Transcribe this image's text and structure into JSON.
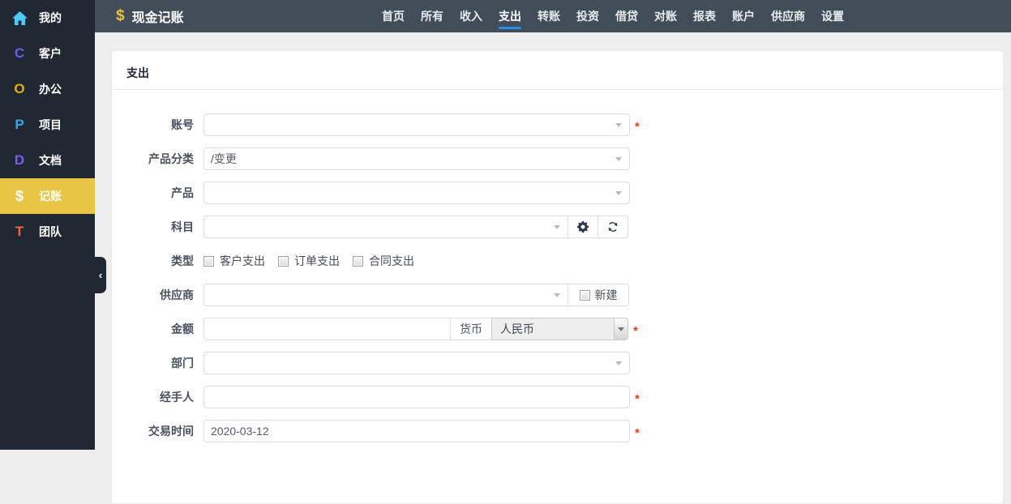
{
  "colors": {
    "sidebar_bg": "#212834",
    "sidebar_active_bg": "#e9c546",
    "topbar_bg": "#414d59",
    "nav_active_underline": "#2d8cf0",
    "required_red": "#ed4014",
    "card_bg": "#ffffff",
    "page_bg": "#eeeeee"
  },
  "sidebar": {
    "items": [
      {
        "label": "我的",
        "icon": "home-icon",
        "glyph": "",
        "active": false
      },
      {
        "label": "客户",
        "icon": "letter-c-icon",
        "glyph": "C",
        "active": false
      },
      {
        "label": "办公",
        "icon": "letter-o-icon",
        "glyph": "O",
        "active": false
      },
      {
        "label": "项目",
        "icon": "letter-p-icon",
        "glyph": "P",
        "active": false
      },
      {
        "label": "文档",
        "icon": "letter-d-icon",
        "glyph": "D",
        "active": false
      },
      {
        "label": "记账",
        "icon": "dollar-icon",
        "glyph": "$",
        "active": true
      },
      {
        "label": "团队",
        "icon": "letter-t-icon",
        "glyph": "T",
        "active": false
      }
    ],
    "collapse_glyph": "‹"
  },
  "topbar": {
    "logo_glyph": "$",
    "title": "现金记账",
    "nav": [
      {
        "label": "首页",
        "active": false
      },
      {
        "label": "所有",
        "active": false
      },
      {
        "label": "收入",
        "active": false
      },
      {
        "label": "支出",
        "active": true
      },
      {
        "label": "转账",
        "active": false
      },
      {
        "label": "投资",
        "active": false
      },
      {
        "label": "借贷",
        "active": false
      },
      {
        "label": "对账",
        "active": false
      },
      {
        "label": "报表",
        "active": false
      },
      {
        "label": "账户",
        "active": false
      },
      {
        "label": "供应商",
        "active": false
      },
      {
        "label": "设置",
        "active": false
      }
    ]
  },
  "form": {
    "card_title": "支出",
    "required_marker": "*",
    "fields": {
      "account": {
        "label": "账号",
        "value": "",
        "required": true
      },
      "product_category": {
        "label": "产品分类",
        "value": "/变更",
        "required": false
      },
      "product": {
        "label": "产品",
        "value": "",
        "required": false
      },
      "subject": {
        "label": "科目",
        "value": "",
        "required": false,
        "buttons": [
          "gear-icon",
          "refresh-icon"
        ]
      },
      "type": {
        "label": "类型",
        "options": [
          "客户支出",
          "订单支出",
          "合同支出"
        ],
        "checked": [
          false,
          false,
          false
        ]
      },
      "supplier": {
        "label": "供应商",
        "value": "",
        "new_label": "新建",
        "new_checked": false
      },
      "amount": {
        "label": "金额",
        "value": "",
        "required": true,
        "currency_label": "货币",
        "currency_value": "人民币"
      },
      "department": {
        "label": "部门",
        "value": "",
        "required": false
      },
      "handler": {
        "label": "经手人",
        "value": "",
        "required": true
      },
      "transaction_time": {
        "label": "交易时间",
        "value": "2020-03-12",
        "required": true
      }
    }
  }
}
